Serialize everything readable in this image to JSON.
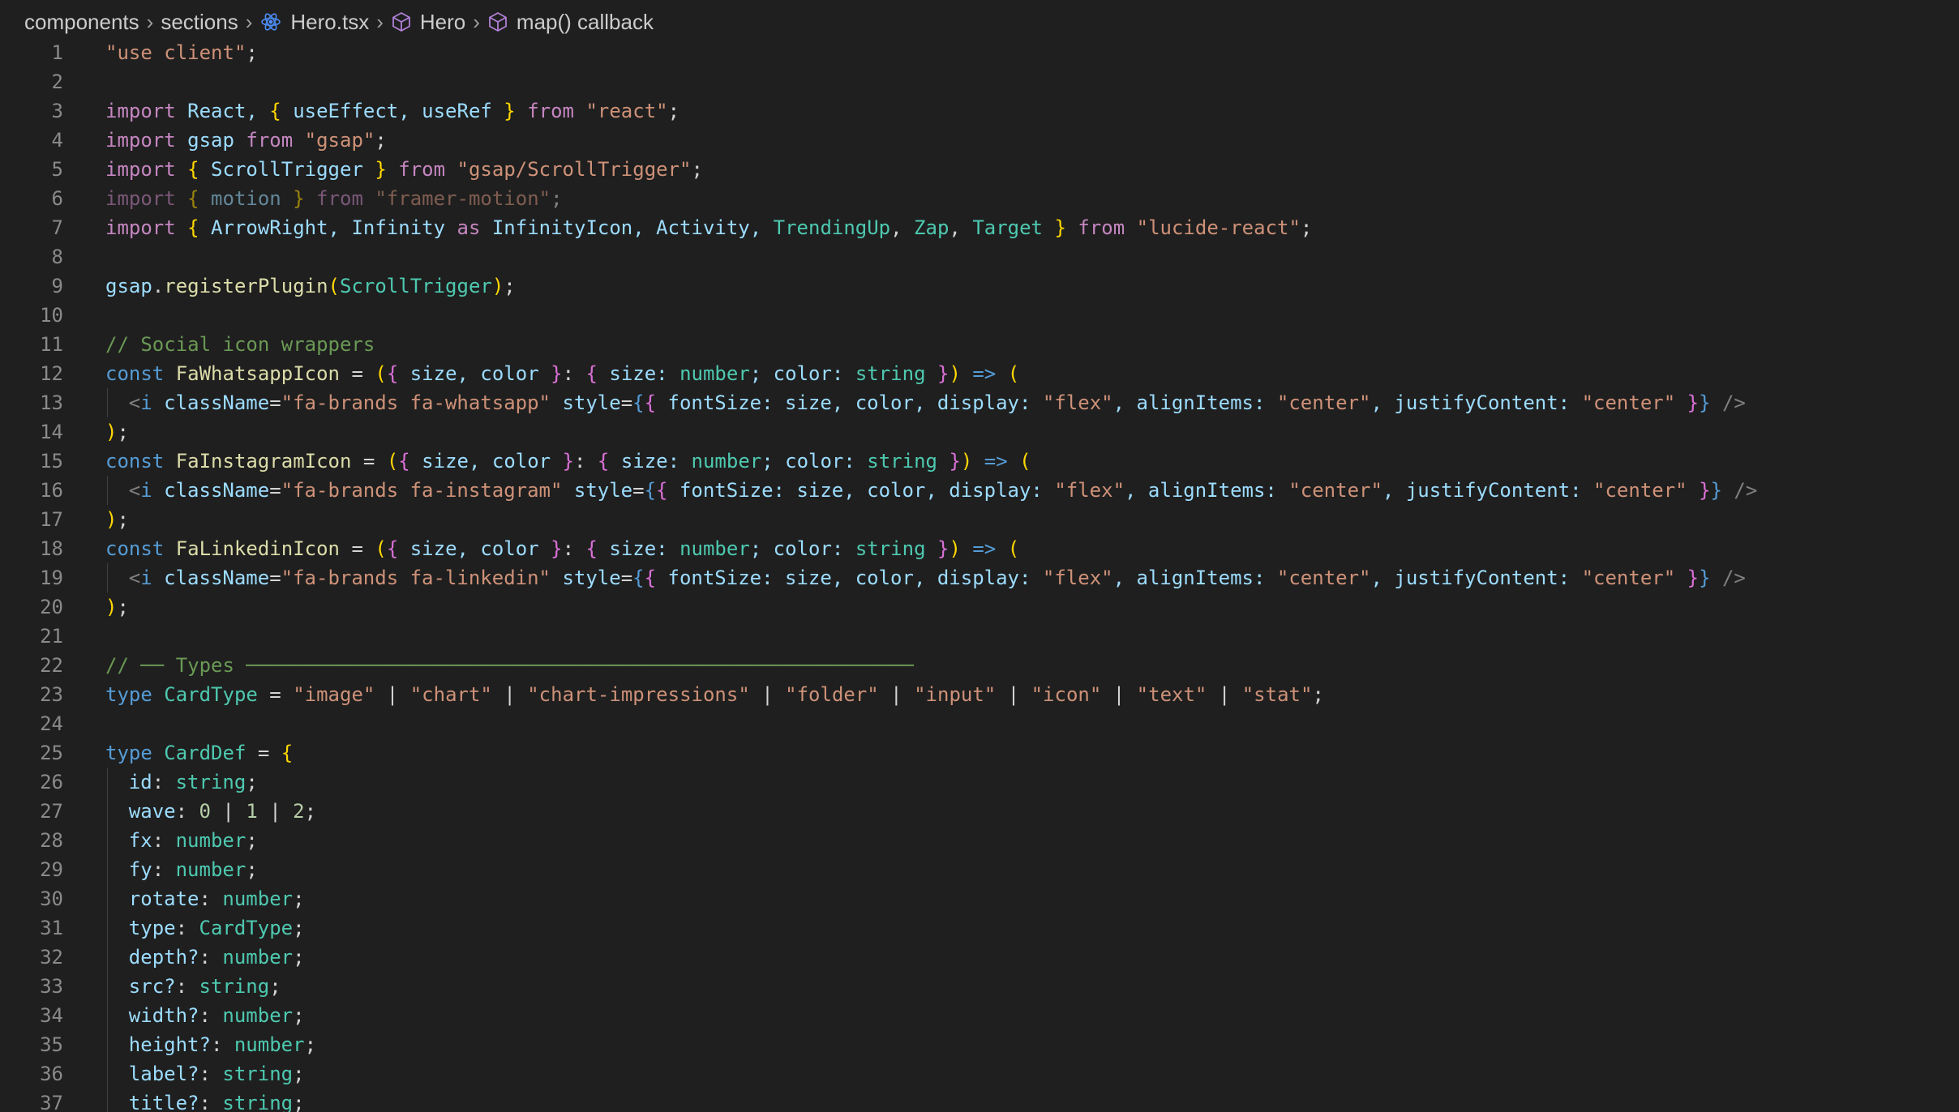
{
  "breadcrumb": {
    "items": [
      {
        "label": "components",
        "icon": null
      },
      {
        "label": "sections",
        "icon": null
      },
      {
        "label": "Hero.tsx",
        "icon": "react-icon"
      },
      {
        "label": "Hero",
        "icon": "cube-icon"
      },
      {
        "label": "map() callback",
        "icon": "cube-icon"
      }
    ]
  },
  "colors": {
    "background": "#1f1f1f",
    "line_number": "#8a8a8a",
    "keyword": "#c586c0",
    "keyword_blue": "#569cd6",
    "string": "#ce9178",
    "variable": "#9cdcfe",
    "type": "#4ec9b0",
    "function": "#dcdcaa",
    "number": "#b5cea8",
    "comment": "#6a9955",
    "bracket_1": "#ffd700",
    "bracket_2": "#da70d6",
    "bracket_3": "#179fff"
  },
  "lines": [
    {
      "n": "1",
      "indent": 0,
      "dim": false,
      "tokens": [
        [
          "\"use client\"",
          "str"
        ],
        [
          ";",
          "pun"
        ]
      ]
    },
    {
      "n": "2",
      "indent": 0,
      "dim": false,
      "tokens": []
    },
    {
      "n": "3",
      "indent": 0,
      "dim": false,
      "tokens": [
        [
          "import",
          "kw"
        ],
        [
          " React, ",
          "var"
        ],
        [
          "{",
          "b1"
        ],
        [
          " useEffect, useRef ",
          "var"
        ],
        [
          "}",
          "b1"
        ],
        [
          " ",
          "pun"
        ],
        [
          "from",
          "kw"
        ],
        [
          " ",
          "pun"
        ],
        [
          "\"react\"",
          "str"
        ],
        [
          ";",
          "pun"
        ]
      ]
    },
    {
      "n": "4",
      "indent": 0,
      "dim": false,
      "tokens": [
        [
          "import",
          "kw"
        ],
        [
          " gsap ",
          "var"
        ],
        [
          "from",
          "kw"
        ],
        [
          " ",
          "pun"
        ],
        [
          "\"gsap\"",
          "str"
        ],
        [
          ";",
          "pun"
        ]
      ]
    },
    {
      "n": "5",
      "indent": 0,
      "dim": false,
      "tokens": [
        [
          "import",
          "kw"
        ],
        [
          " ",
          "pun"
        ],
        [
          "{",
          "b1"
        ],
        [
          " ScrollTrigger ",
          "var"
        ],
        [
          "}",
          "b1"
        ],
        [
          " ",
          "pun"
        ],
        [
          "from",
          "kw"
        ],
        [
          " ",
          "pun"
        ],
        [
          "\"gsap/ScrollTrigger\"",
          "str"
        ],
        [
          ";",
          "pun"
        ]
      ]
    },
    {
      "n": "6",
      "indent": 0,
      "dim": true,
      "tokens": [
        [
          "import",
          "kw"
        ],
        [
          " ",
          "pun"
        ],
        [
          "{",
          "b1"
        ],
        [
          " motion ",
          "var"
        ],
        [
          "}",
          "b1"
        ],
        [
          " ",
          "pun"
        ],
        [
          "from",
          "kw"
        ],
        [
          " ",
          "pun"
        ],
        [
          "\"framer-motion\"",
          "str"
        ],
        [
          ";",
          "pun"
        ]
      ]
    },
    {
      "n": "7",
      "indent": 0,
      "dim": false,
      "tokens": [
        [
          "import",
          "kw"
        ],
        [
          " ",
          "pun"
        ],
        [
          "{",
          "b1"
        ],
        [
          " ArrowRight, Infinity ",
          "var"
        ],
        [
          "as",
          "kw"
        ],
        [
          " InfinityIcon, Activity, ",
          "var"
        ],
        [
          "TrendingUp",
          "typ"
        ],
        [
          ", ",
          "pun"
        ],
        [
          "Zap",
          "typ"
        ],
        [
          ", ",
          "pun"
        ],
        [
          "Target",
          "typ"
        ],
        [
          " ",
          "pun"
        ],
        [
          "}",
          "b1"
        ],
        [
          " ",
          "pun"
        ],
        [
          "from",
          "kw"
        ],
        [
          " ",
          "pun"
        ],
        [
          "\"lucide-react\"",
          "str"
        ],
        [
          ";",
          "pun"
        ]
      ]
    },
    {
      "n": "8",
      "indent": 0,
      "dim": false,
      "tokens": []
    },
    {
      "n": "9",
      "indent": 0,
      "dim": false,
      "tokens": [
        [
          "gsap",
          "var"
        ],
        [
          ".",
          "pun"
        ],
        [
          "registerPlugin",
          "fn"
        ],
        [
          "(",
          "b1"
        ],
        [
          "ScrollTrigger",
          "typ"
        ],
        [
          ")",
          "b1"
        ],
        [
          ";",
          "pun"
        ]
      ]
    },
    {
      "n": "10",
      "indent": 0,
      "dim": false,
      "tokens": []
    },
    {
      "n": "11",
      "indent": 0,
      "dim": false,
      "tokens": [
        [
          "// Social icon wrappers",
          "cmt"
        ]
      ]
    },
    {
      "n": "12",
      "indent": 0,
      "dim": false,
      "tokens": [
        [
          "const",
          "kwb"
        ],
        [
          " ",
          "pun"
        ],
        [
          "FaWhatsappIcon",
          "fn"
        ],
        [
          " = ",
          "pun"
        ],
        [
          "(",
          "b1"
        ],
        [
          "{",
          "b2"
        ],
        [
          " size, color ",
          "var"
        ],
        [
          "}",
          "b2"
        ],
        [
          ": ",
          "pun"
        ],
        [
          "{",
          "b2"
        ],
        [
          " size: ",
          "var"
        ],
        [
          "number",
          "typ"
        ],
        [
          "; color: ",
          "var"
        ],
        [
          "string",
          "typ"
        ],
        [
          " ",
          "pun"
        ],
        [
          "}",
          "b2"
        ],
        [
          ")",
          "b1"
        ],
        [
          " ",
          "pun"
        ],
        [
          "=>",
          "kwb"
        ],
        [
          " ",
          "pun"
        ],
        [
          "(",
          "b1"
        ]
      ]
    },
    {
      "n": "13",
      "indent": 1,
      "dim": false,
      "tokens": [
        [
          "<",
          "tag"
        ],
        [
          "i",
          "kwb"
        ],
        [
          " className",
          "var"
        ],
        [
          "=",
          "pun"
        ],
        [
          "\"fa-brands fa-whatsapp\"",
          "str"
        ],
        [
          " style",
          "var"
        ],
        [
          "=",
          "pun"
        ],
        [
          "{",
          "kwb"
        ],
        [
          "{",
          "b2"
        ],
        [
          " fontSize: size, color, display: ",
          "var"
        ],
        [
          "\"flex\"",
          "str"
        ],
        [
          ", alignItems: ",
          "var"
        ],
        [
          "\"center\"",
          "str"
        ],
        [
          ", justifyContent: ",
          "var"
        ],
        [
          "\"center\"",
          "str"
        ],
        [
          " ",
          "pun"
        ],
        [
          "}",
          "b2"
        ],
        [
          "}",
          "kwb"
        ],
        [
          " />",
          "tag"
        ]
      ]
    },
    {
      "n": "14",
      "indent": 0,
      "dim": false,
      "tokens": [
        [
          ")",
          "b1"
        ],
        [
          ";",
          "pun"
        ]
      ]
    },
    {
      "n": "15",
      "indent": 0,
      "dim": false,
      "tokens": [
        [
          "const",
          "kwb"
        ],
        [
          " ",
          "pun"
        ],
        [
          "FaInstagramIcon",
          "fn"
        ],
        [
          " = ",
          "pun"
        ],
        [
          "(",
          "b1"
        ],
        [
          "{",
          "b2"
        ],
        [
          " size, color ",
          "var"
        ],
        [
          "}",
          "b2"
        ],
        [
          ": ",
          "pun"
        ],
        [
          "{",
          "b2"
        ],
        [
          " size: ",
          "var"
        ],
        [
          "number",
          "typ"
        ],
        [
          "; color: ",
          "var"
        ],
        [
          "string",
          "typ"
        ],
        [
          " ",
          "pun"
        ],
        [
          "}",
          "b2"
        ],
        [
          ")",
          "b1"
        ],
        [
          " ",
          "pun"
        ],
        [
          "=>",
          "kwb"
        ],
        [
          " ",
          "pun"
        ],
        [
          "(",
          "b1"
        ]
      ]
    },
    {
      "n": "16",
      "indent": 1,
      "dim": false,
      "tokens": [
        [
          "<",
          "tag"
        ],
        [
          "i",
          "kwb"
        ],
        [
          " className",
          "var"
        ],
        [
          "=",
          "pun"
        ],
        [
          "\"fa-brands fa-instagram\"",
          "str"
        ],
        [
          " style",
          "var"
        ],
        [
          "=",
          "pun"
        ],
        [
          "{",
          "kwb"
        ],
        [
          "{",
          "b2"
        ],
        [
          " fontSize: size, color, display: ",
          "var"
        ],
        [
          "\"flex\"",
          "str"
        ],
        [
          ", alignItems: ",
          "var"
        ],
        [
          "\"center\"",
          "str"
        ],
        [
          ", justifyContent: ",
          "var"
        ],
        [
          "\"center\"",
          "str"
        ],
        [
          " ",
          "pun"
        ],
        [
          "}",
          "b2"
        ],
        [
          "}",
          "kwb"
        ],
        [
          " />",
          "tag"
        ]
      ]
    },
    {
      "n": "17",
      "indent": 0,
      "dim": false,
      "tokens": [
        [
          ")",
          "b1"
        ],
        [
          ";",
          "pun"
        ]
      ]
    },
    {
      "n": "18",
      "indent": 0,
      "dim": false,
      "tokens": [
        [
          "const",
          "kwb"
        ],
        [
          " ",
          "pun"
        ],
        [
          "FaLinkedinIcon",
          "fn"
        ],
        [
          " = ",
          "pun"
        ],
        [
          "(",
          "b1"
        ],
        [
          "{",
          "b2"
        ],
        [
          " size, color ",
          "var"
        ],
        [
          "}",
          "b2"
        ],
        [
          ": ",
          "pun"
        ],
        [
          "{",
          "b2"
        ],
        [
          " size: ",
          "var"
        ],
        [
          "number",
          "typ"
        ],
        [
          "; color: ",
          "var"
        ],
        [
          "string",
          "typ"
        ],
        [
          " ",
          "pun"
        ],
        [
          "}",
          "b2"
        ],
        [
          ")",
          "b1"
        ],
        [
          " ",
          "pun"
        ],
        [
          "=>",
          "kwb"
        ],
        [
          " ",
          "pun"
        ],
        [
          "(",
          "b1"
        ]
      ]
    },
    {
      "n": "19",
      "indent": 1,
      "dim": false,
      "tokens": [
        [
          "<",
          "tag"
        ],
        [
          "i",
          "kwb"
        ],
        [
          " className",
          "var"
        ],
        [
          "=",
          "pun"
        ],
        [
          "\"fa-brands fa-linkedin\"",
          "str"
        ],
        [
          " style",
          "var"
        ],
        [
          "=",
          "pun"
        ],
        [
          "{",
          "kwb"
        ],
        [
          "{",
          "b2"
        ],
        [
          " fontSize: size, color, display: ",
          "var"
        ],
        [
          "\"flex\"",
          "str"
        ],
        [
          ", alignItems: ",
          "var"
        ],
        [
          "\"center\"",
          "str"
        ],
        [
          ", justifyContent: ",
          "var"
        ],
        [
          "\"center\"",
          "str"
        ],
        [
          " ",
          "pun"
        ],
        [
          "}",
          "b2"
        ],
        [
          "}",
          "kwb"
        ],
        [
          " />",
          "tag"
        ]
      ]
    },
    {
      "n": "20",
      "indent": 0,
      "dim": false,
      "tokens": [
        [
          ")",
          "b1"
        ],
        [
          ";",
          "pun"
        ]
      ]
    },
    {
      "n": "21",
      "indent": 0,
      "dim": false,
      "tokens": []
    },
    {
      "n": "22",
      "indent": 0,
      "dim": false,
      "tokens": [
        [
          "// ── Types ─────────────────────────────────────────────────────────",
          "cmt"
        ]
      ]
    },
    {
      "n": "23",
      "indent": 0,
      "dim": false,
      "tokens": [
        [
          "type",
          "kwb"
        ],
        [
          " ",
          "pun"
        ],
        [
          "CardType",
          "typ"
        ],
        [
          " = ",
          "pun"
        ],
        [
          "\"image\"",
          "str"
        ],
        [
          " | ",
          "pun"
        ],
        [
          "\"chart\"",
          "str"
        ],
        [
          " | ",
          "pun"
        ],
        [
          "\"chart-impressions\"",
          "str"
        ],
        [
          " | ",
          "pun"
        ],
        [
          "\"folder\"",
          "str"
        ],
        [
          " | ",
          "pun"
        ],
        [
          "\"input\"",
          "str"
        ],
        [
          " | ",
          "pun"
        ],
        [
          "\"icon\"",
          "str"
        ],
        [
          " | ",
          "pun"
        ],
        [
          "\"text\"",
          "str"
        ],
        [
          " | ",
          "pun"
        ],
        [
          "\"stat\"",
          "str"
        ],
        [
          ";",
          "pun"
        ]
      ]
    },
    {
      "n": "24",
      "indent": 0,
      "dim": false,
      "tokens": []
    },
    {
      "n": "25",
      "indent": 0,
      "dim": false,
      "tokens": [
        [
          "type",
          "kwb"
        ],
        [
          " ",
          "pun"
        ],
        [
          "CardDef",
          "typ"
        ],
        [
          " = ",
          "pun"
        ],
        [
          "{",
          "b1"
        ]
      ]
    },
    {
      "n": "26",
      "indent": 1,
      "dim": false,
      "tokens": [
        [
          "id",
          "var"
        ],
        [
          ": ",
          "pun"
        ],
        [
          "string",
          "typ"
        ],
        [
          ";",
          "pun"
        ]
      ]
    },
    {
      "n": "27",
      "indent": 1,
      "dim": false,
      "tokens": [
        [
          "wave",
          "var"
        ],
        [
          ": ",
          "pun"
        ],
        [
          "0",
          "num"
        ],
        [
          " | ",
          "pun"
        ],
        [
          "1",
          "num"
        ],
        [
          " | ",
          "pun"
        ],
        [
          "2",
          "num"
        ],
        [
          ";",
          "pun"
        ]
      ]
    },
    {
      "n": "28",
      "indent": 1,
      "dim": false,
      "tokens": [
        [
          "fx",
          "var"
        ],
        [
          ": ",
          "pun"
        ],
        [
          "number",
          "typ"
        ],
        [
          ";",
          "pun"
        ]
      ]
    },
    {
      "n": "29",
      "indent": 1,
      "dim": false,
      "tokens": [
        [
          "fy",
          "var"
        ],
        [
          ": ",
          "pun"
        ],
        [
          "number",
          "typ"
        ],
        [
          ";",
          "pun"
        ]
      ]
    },
    {
      "n": "30",
      "indent": 1,
      "dim": false,
      "tokens": [
        [
          "rotate",
          "var"
        ],
        [
          ": ",
          "pun"
        ],
        [
          "number",
          "typ"
        ],
        [
          ";",
          "pun"
        ]
      ]
    },
    {
      "n": "31",
      "indent": 1,
      "dim": false,
      "tokens": [
        [
          "type",
          "var"
        ],
        [
          ": ",
          "pun"
        ],
        [
          "CardType",
          "typ"
        ],
        [
          ";",
          "pun"
        ]
      ]
    },
    {
      "n": "32",
      "indent": 1,
      "dim": false,
      "tokens": [
        [
          "depth?",
          "var"
        ],
        [
          ": ",
          "pun"
        ],
        [
          "number",
          "typ"
        ],
        [
          ";",
          "pun"
        ]
      ]
    },
    {
      "n": "33",
      "indent": 1,
      "dim": false,
      "tokens": [
        [
          "src?",
          "var"
        ],
        [
          ": ",
          "pun"
        ],
        [
          "string",
          "typ"
        ],
        [
          ";",
          "pun"
        ]
      ]
    },
    {
      "n": "34",
      "indent": 1,
      "dim": false,
      "tokens": [
        [
          "width?",
          "var"
        ],
        [
          ": ",
          "pun"
        ],
        [
          "number",
          "typ"
        ],
        [
          ";",
          "pun"
        ]
      ]
    },
    {
      "n": "35",
      "indent": 1,
      "dim": false,
      "tokens": [
        [
          "height?",
          "var"
        ],
        [
          ": ",
          "pun"
        ],
        [
          "number",
          "typ"
        ],
        [
          ";",
          "pun"
        ]
      ]
    },
    {
      "n": "36",
      "indent": 1,
      "dim": false,
      "tokens": [
        [
          "label?",
          "var"
        ],
        [
          ": ",
          "pun"
        ],
        [
          "string",
          "typ"
        ],
        [
          ";",
          "pun"
        ]
      ]
    },
    {
      "n": "37",
      "indent": 1,
      "dim": false,
      "tokens": [
        [
          "title?",
          "var"
        ],
        [
          ": ",
          "pun"
        ],
        [
          "string",
          "typ"
        ],
        [
          ";",
          "pun"
        ]
      ]
    }
  ]
}
